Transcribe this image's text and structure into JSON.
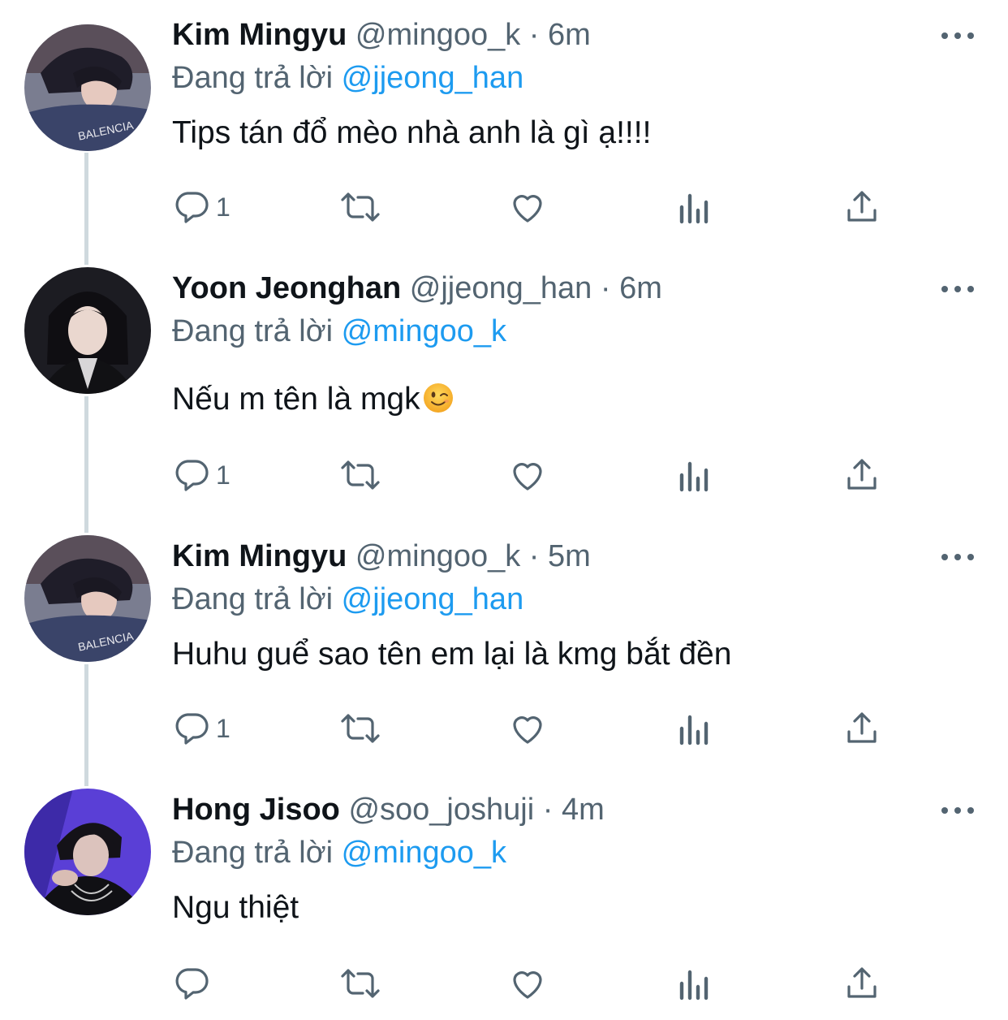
{
  "tweets": [
    {
      "name": "Kim Mingyu",
      "handle": "@mingoo_k",
      "sep": "·",
      "time": "6m",
      "replying_prefix": "Đang trả lời",
      "replying_to": "@jjeong_han",
      "text": "Tips tán đổ mèo nhà anh là gì ạ!!!!",
      "reply_count": "1"
    },
    {
      "name": "Yoon Jeonghan",
      "handle": "@jjeong_han",
      "sep": "·",
      "time": "6m",
      "replying_prefix": "Đang trả lời",
      "replying_to": "@mingoo_k",
      "text": "Nếu m tên là mgk",
      "reply_count": "1"
    },
    {
      "name": "Kim Mingyu",
      "handle": "@mingoo_k",
      "sep": "·",
      "time": "5m",
      "replying_prefix": "Đang trả lời",
      "replying_to": "@jjeong_han",
      "text": "Huhu guể sao tên em lại là kmg bắt đền",
      "reply_count": "1"
    },
    {
      "name": "Hong Jisoo",
      "handle": "@soo_joshuji",
      "sep": "·",
      "time": "4m",
      "replying_prefix": "Đang trả lời",
      "replying_to": "@mingoo_k",
      "text": "Ngu thiệt",
      "reply_count": ""
    }
  ],
  "icons": {
    "reply": "reply-icon",
    "retweet": "retweet-icon",
    "like": "heart-icon",
    "views": "views-icon",
    "share": "share-icon",
    "more": "more-icon",
    "emoji": "wink-emoji-icon"
  },
  "colors": {
    "text": "#0f1419",
    "secondary": "#536471",
    "mention": "#1d9bf0",
    "thread_line": "#cfd9de"
  }
}
